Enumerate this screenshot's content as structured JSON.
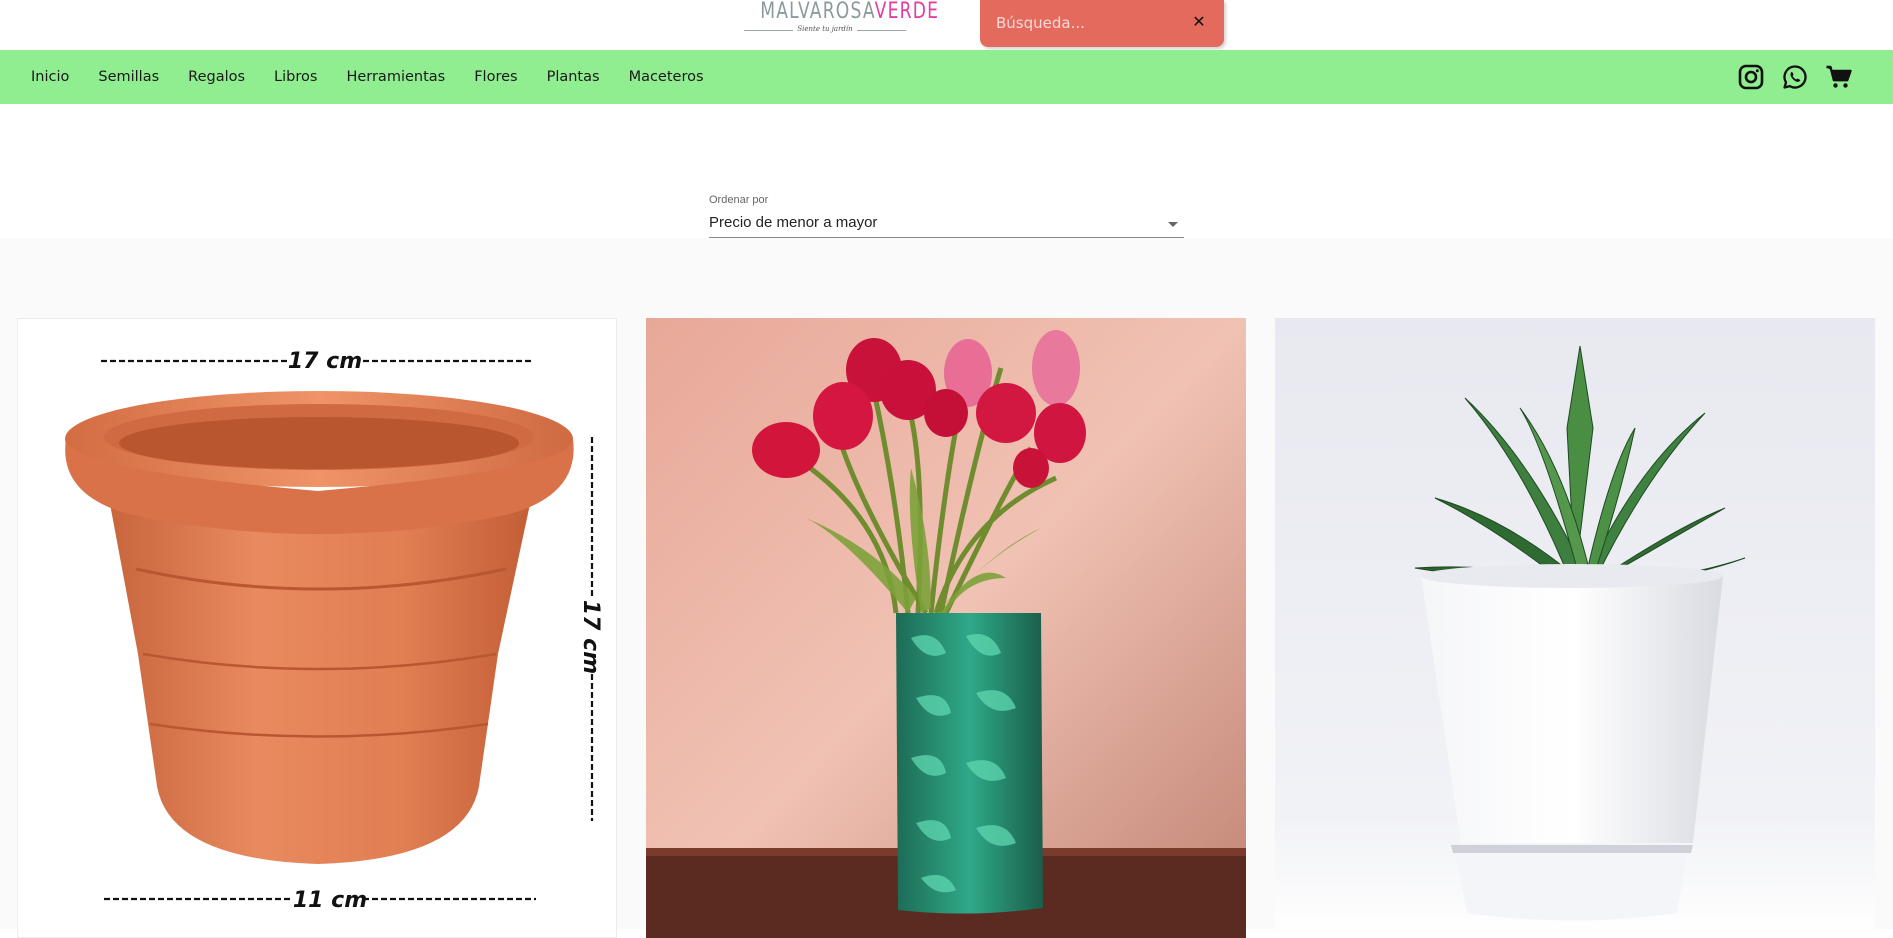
{
  "header": {
    "logo": {
      "part1": "MALVAROSA",
      "part2": "VERDE",
      "tagline": "Siente tu jardín",
      "colors": {
        "part1": "#8a9a9c",
        "part2": "#e33ea0"
      }
    },
    "search": {
      "placeholder": "Búsqueda...",
      "value": "",
      "close_icon": "close-icon",
      "background": "#e46a5d"
    }
  },
  "nav": {
    "background": "#90ee90",
    "items": [
      {
        "label": "Inicio"
      },
      {
        "label": "Semillas"
      },
      {
        "label": "Regalos"
      },
      {
        "label": "Libros"
      },
      {
        "label": "Herramientas"
      },
      {
        "label": "Flores"
      },
      {
        "label": "Plantas"
      },
      {
        "label": "Maceteros"
      }
    ],
    "icons": [
      "instagram-icon",
      "whatsapp-icon",
      "cart-icon"
    ]
  },
  "sort": {
    "label": "Ordenar por",
    "selected": "Precio de menor a mayor"
  },
  "products": [
    {
      "image": "terracotta-pot-image",
      "labels": {
        "top": "17 cm",
        "side": "17 cm",
        "bottom": "11 cm"
      }
    },
    {
      "image": "tulips-vase-image"
    },
    {
      "image": "aloe-white-pot-image"
    }
  ]
}
